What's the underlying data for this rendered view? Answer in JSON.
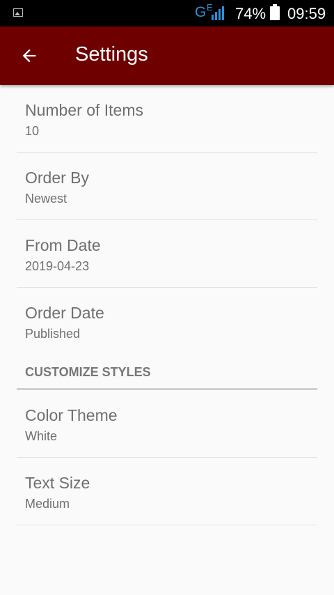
{
  "status_bar": {
    "network_letter": "G",
    "network_sub": "E",
    "battery_percent": "74%",
    "time": "09:59",
    "colors": {
      "network": "#2b8fd6"
    }
  },
  "app_bar": {
    "title": "Settings",
    "back_icon": "arrow-left-icon",
    "color": "#6e0000"
  },
  "preferences": [
    {
      "title": "Number of Items",
      "summary": "10"
    },
    {
      "title": "Order By",
      "summary": "Newest"
    },
    {
      "title": "From Date",
      "summary": "2019-04-23"
    },
    {
      "title": "Order Date",
      "summary": "Published"
    }
  ],
  "category": {
    "title": "CUSTOMIZE STYLES"
  },
  "style_preferences": [
    {
      "title": "Color Theme",
      "summary": "White"
    },
    {
      "title": "Text Size",
      "summary": "Medium"
    }
  ]
}
